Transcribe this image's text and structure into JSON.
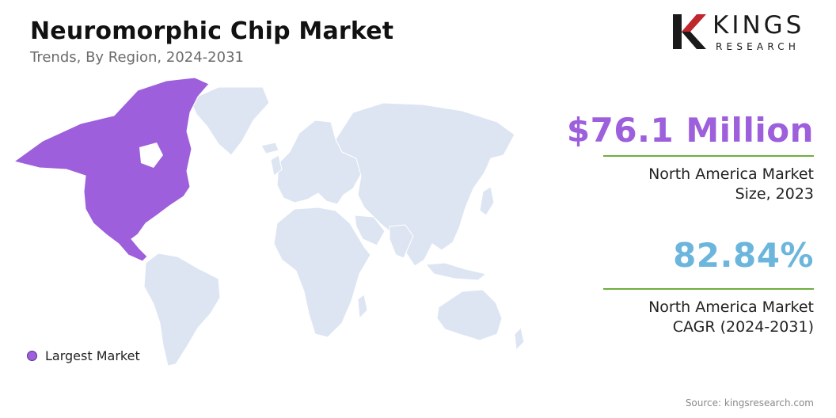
{
  "header": {
    "title": "Neuromorphic Chip Market",
    "subtitle": "Trends, By Region, 2024-2031"
  },
  "logo": {
    "primary": "KINGS",
    "secondary": "RESEARCH"
  },
  "map": {
    "highlighted_region": "North America",
    "highlight_color": "#9d5fdb",
    "base_color": "#dde5f3"
  },
  "legend": {
    "label": "Largest Market"
  },
  "stats": {
    "market_size_value": "$76.1 Million",
    "market_size_label_line1": "North America Market",
    "market_size_label_line2": "Size, 2023",
    "cagr_value": "82.84%",
    "cagr_label_line1": "North America Market",
    "cagr_label_line2": "CAGR (2024-2031)"
  },
  "colors": {
    "accent_purple": "#9d5fdb",
    "accent_blue": "#6cb6dd",
    "divider_green": "#6fae3f",
    "logo_red": "#c0262d"
  },
  "footer": {
    "source": "Source: kingsresearch.com"
  }
}
